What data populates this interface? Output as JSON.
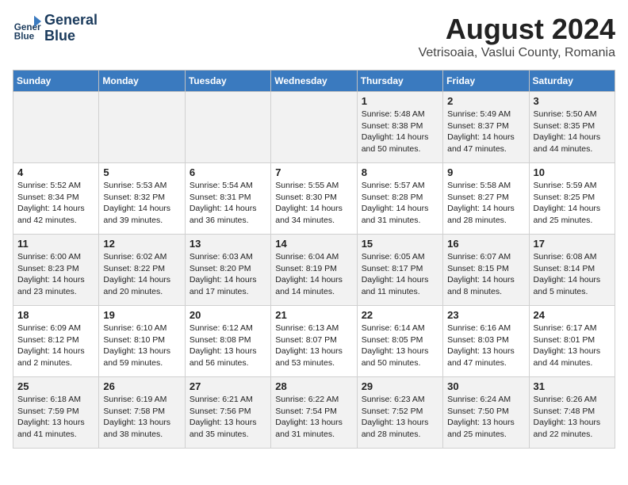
{
  "header": {
    "logo_line1": "General",
    "logo_line2": "Blue",
    "title": "August 2024",
    "subtitle": "Vetrisoaia, Vaslui County, Romania"
  },
  "days_of_week": [
    "Sunday",
    "Monday",
    "Tuesday",
    "Wednesday",
    "Thursday",
    "Friday",
    "Saturday"
  ],
  "weeks": [
    [
      {
        "day": "",
        "text": ""
      },
      {
        "day": "",
        "text": ""
      },
      {
        "day": "",
        "text": ""
      },
      {
        "day": "",
        "text": ""
      },
      {
        "day": "1",
        "text": "Sunrise: 5:48 AM\nSunset: 8:38 PM\nDaylight: 14 hours and 50 minutes."
      },
      {
        "day": "2",
        "text": "Sunrise: 5:49 AM\nSunset: 8:37 PM\nDaylight: 14 hours and 47 minutes."
      },
      {
        "day": "3",
        "text": "Sunrise: 5:50 AM\nSunset: 8:35 PM\nDaylight: 14 hours and 44 minutes."
      }
    ],
    [
      {
        "day": "4",
        "text": "Sunrise: 5:52 AM\nSunset: 8:34 PM\nDaylight: 14 hours and 42 minutes."
      },
      {
        "day": "5",
        "text": "Sunrise: 5:53 AM\nSunset: 8:32 PM\nDaylight: 14 hours and 39 minutes."
      },
      {
        "day": "6",
        "text": "Sunrise: 5:54 AM\nSunset: 8:31 PM\nDaylight: 14 hours and 36 minutes."
      },
      {
        "day": "7",
        "text": "Sunrise: 5:55 AM\nSunset: 8:30 PM\nDaylight: 14 hours and 34 minutes."
      },
      {
        "day": "8",
        "text": "Sunrise: 5:57 AM\nSunset: 8:28 PM\nDaylight: 14 hours and 31 minutes."
      },
      {
        "day": "9",
        "text": "Sunrise: 5:58 AM\nSunset: 8:27 PM\nDaylight: 14 hours and 28 minutes."
      },
      {
        "day": "10",
        "text": "Sunrise: 5:59 AM\nSunset: 8:25 PM\nDaylight: 14 hours and 25 minutes."
      }
    ],
    [
      {
        "day": "11",
        "text": "Sunrise: 6:00 AM\nSunset: 8:23 PM\nDaylight: 14 hours and 23 minutes."
      },
      {
        "day": "12",
        "text": "Sunrise: 6:02 AM\nSunset: 8:22 PM\nDaylight: 14 hours and 20 minutes."
      },
      {
        "day": "13",
        "text": "Sunrise: 6:03 AM\nSunset: 8:20 PM\nDaylight: 14 hours and 17 minutes."
      },
      {
        "day": "14",
        "text": "Sunrise: 6:04 AM\nSunset: 8:19 PM\nDaylight: 14 hours and 14 minutes."
      },
      {
        "day": "15",
        "text": "Sunrise: 6:05 AM\nSunset: 8:17 PM\nDaylight: 14 hours and 11 minutes."
      },
      {
        "day": "16",
        "text": "Sunrise: 6:07 AM\nSunset: 8:15 PM\nDaylight: 14 hours and 8 minutes."
      },
      {
        "day": "17",
        "text": "Sunrise: 6:08 AM\nSunset: 8:14 PM\nDaylight: 14 hours and 5 minutes."
      }
    ],
    [
      {
        "day": "18",
        "text": "Sunrise: 6:09 AM\nSunset: 8:12 PM\nDaylight: 14 hours and 2 minutes."
      },
      {
        "day": "19",
        "text": "Sunrise: 6:10 AM\nSunset: 8:10 PM\nDaylight: 13 hours and 59 minutes."
      },
      {
        "day": "20",
        "text": "Sunrise: 6:12 AM\nSunset: 8:08 PM\nDaylight: 13 hours and 56 minutes."
      },
      {
        "day": "21",
        "text": "Sunrise: 6:13 AM\nSunset: 8:07 PM\nDaylight: 13 hours and 53 minutes."
      },
      {
        "day": "22",
        "text": "Sunrise: 6:14 AM\nSunset: 8:05 PM\nDaylight: 13 hours and 50 minutes."
      },
      {
        "day": "23",
        "text": "Sunrise: 6:16 AM\nSunset: 8:03 PM\nDaylight: 13 hours and 47 minutes."
      },
      {
        "day": "24",
        "text": "Sunrise: 6:17 AM\nSunset: 8:01 PM\nDaylight: 13 hours and 44 minutes."
      }
    ],
    [
      {
        "day": "25",
        "text": "Sunrise: 6:18 AM\nSunset: 7:59 PM\nDaylight: 13 hours and 41 minutes."
      },
      {
        "day": "26",
        "text": "Sunrise: 6:19 AM\nSunset: 7:58 PM\nDaylight: 13 hours and 38 minutes."
      },
      {
        "day": "27",
        "text": "Sunrise: 6:21 AM\nSunset: 7:56 PM\nDaylight: 13 hours and 35 minutes."
      },
      {
        "day": "28",
        "text": "Sunrise: 6:22 AM\nSunset: 7:54 PM\nDaylight: 13 hours and 31 minutes."
      },
      {
        "day": "29",
        "text": "Sunrise: 6:23 AM\nSunset: 7:52 PM\nDaylight: 13 hours and 28 minutes."
      },
      {
        "day": "30",
        "text": "Sunrise: 6:24 AM\nSunset: 7:50 PM\nDaylight: 13 hours and 25 minutes."
      },
      {
        "day": "31",
        "text": "Sunrise: 6:26 AM\nSunset: 7:48 PM\nDaylight: 13 hours and 22 minutes."
      }
    ]
  ]
}
